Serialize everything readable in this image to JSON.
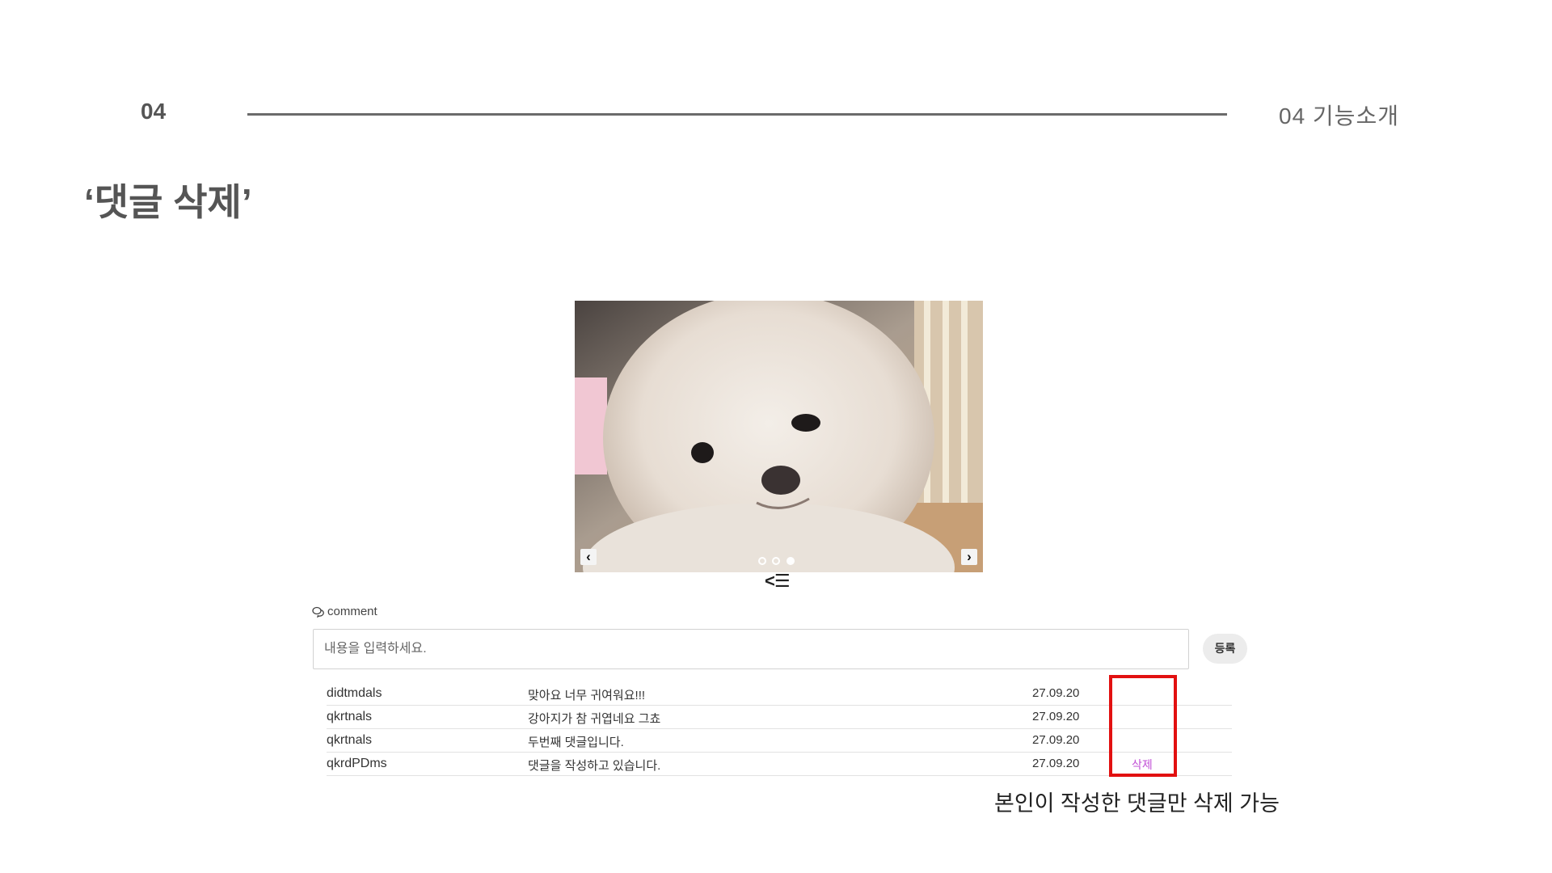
{
  "header": {
    "section_number": "04",
    "section_title": "04  기능소개"
  },
  "page_title": "‘댓글 삭제’",
  "carousel": {
    "prev_icon": "chevron-left-icon",
    "next_icon": "chevron-right-icon",
    "prev_glyph": "‹",
    "next_glyph": "›",
    "dots_total": 3,
    "active_dot": 3
  },
  "list_nav_glyph": "<☰",
  "comments": {
    "label": "comment",
    "input_placeholder": "내용을 입력하세요.",
    "submit_label": "등록",
    "rows": [
      {
        "user": "didtmdals",
        "text": "맞아요 너무 귀여워요!!!",
        "date": "27.09.20",
        "action": ""
      },
      {
        "user": "qkrtnals",
        "text": "강아지가 참 귀엽네요 그쵸",
        "date": "27.09.20",
        "action": ""
      },
      {
        "user": "qkrtnals",
        "text": "두번째 댓글입니다.",
        "date": "27.09.20",
        "action": ""
      },
      {
        "user": "qkrdPDms",
        "text": "댓글을 작성하고 있습니다.",
        "date": "27.09.20",
        "action": "삭제"
      }
    ]
  },
  "annotation": {
    "note": "본인이 작성한 댓글만 삭제 가능",
    "highlight_color": "#e21010"
  },
  "colors": {
    "delete_link": "#c14fd6"
  }
}
